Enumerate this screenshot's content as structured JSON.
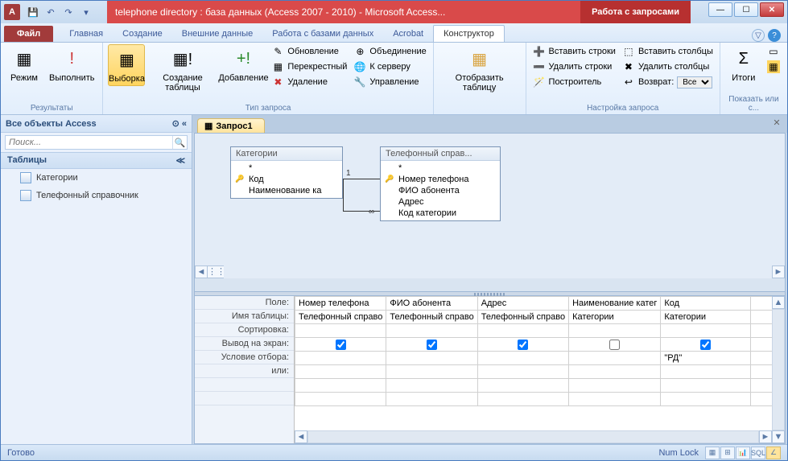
{
  "titlebar": {
    "app_letter": "A",
    "title": "telephone directory : база данных (Access 2007 - 2010)  -  Microsoft Access...",
    "context_label": "Работа с запросами"
  },
  "tabs": {
    "file": "Файл",
    "items": [
      "Главная",
      "Создание",
      "Внешние данные",
      "Работа с базами данных",
      "Acrobat"
    ],
    "contextual": "Конструктор"
  },
  "ribbon": {
    "group_results": {
      "label": "Результаты",
      "mode": "Режим",
      "run": "Выполнить"
    },
    "group_qtype": {
      "label": "Тип запроса",
      "select": "Выборка",
      "maketable": "Создание таблицы",
      "append": "Добавление",
      "update": "Обновление",
      "crosstab": "Перекрестный",
      "delete": "Удаление",
      "union": "Объединение",
      "passthrough": "К серверу",
      "datadef": "Управление"
    },
    "group_showtbl": {
      "label": "",
      "show": "Отобразить таблицу"
    },
    "group_setup": {
      "label": "Настройка запроса",
      "ins_rows": "Вставить строки",
      "del_rows": "Удалить строки",
      "builder": "Построитель",
      "ins_cols": "Вставить столбцы",
      "del_cols": "Удалить столбцы",
      "return_lbl": "Возврат:",
      "return_val": "Все"
    },
    "group_showhide": {
      "label": "Показать или с...",
      "totals": "Итоги"
    }
  },
  "nav": {
    "header": "Все объекты Access",
    "search_placeholder": "Поиск...",
    "group": "Таблицы",
    "items": [
      "Категории",
      "Телефонный справочник"
    ]
  },
  "doc": {
    "tab": "Запрос1"
  },
  "tables": {
    "left": {
      "title": "Категории",
      "star": "*",
      "fields": [
        {
          "name": "Код",
          "key": true
        },
        {
          "name": "Наименование ка",
          "key": false
        }
      ]
    },
    "right": {
      "title": "Телефонный справ...",
      "star": "*",
      "fields": [
        {
          "name": "Номер телефона",
          "key": true
        },
        {
          "name": "ФИО абонента",
          "key": false
        },
        {
          "name": "Адрес",
          "key": false
        },
        {
          "name": "Код категории",
          "key": false
        }
      ]
    },
    "join": {
      "one": "1",
      "many": "∞"
    }
  },
  "grid": {
    "row_labels": [
      "Поле:",
      "Имя таблицы:",
      "Сортировка:",
      "Вывод на экран:",
      "Условие отбора:",
      "или:"
    ],
    "cols": [
      {
        "field": "Номер телефона",
        "table": "Телефонный справо",
        "sort": "",
        "show": true,
        "crit": "",
        "or": ""
      },
      {
        "field": "ФИО абонента",
        "table": "Телефонный справо",
        "sort": "",
        "show": true,
        "crit": "",
        "or": ""
      },
      {
        "field": "Адрес",
        "table": "Телефонный справо",
        "sort": "",
        "show": true,
        "crit": "",
        "or": ""
      },
      {
        "field": "Наименование катег",
        "table": "Категории",
        "sort": "",
        "show": false,
        "crit": "",
        "or": ""
      },
      {
        "field": "Код",
        "table": "Категории",
        "sort": "",
        "show": true,
        "crit": "\"РД\"",
        "or": ""
      }
    ]
  },
  "status": {
    "ready": "Готово",
    "numlock": "Num Lock",
    "sql": "SQL"
  }
}
